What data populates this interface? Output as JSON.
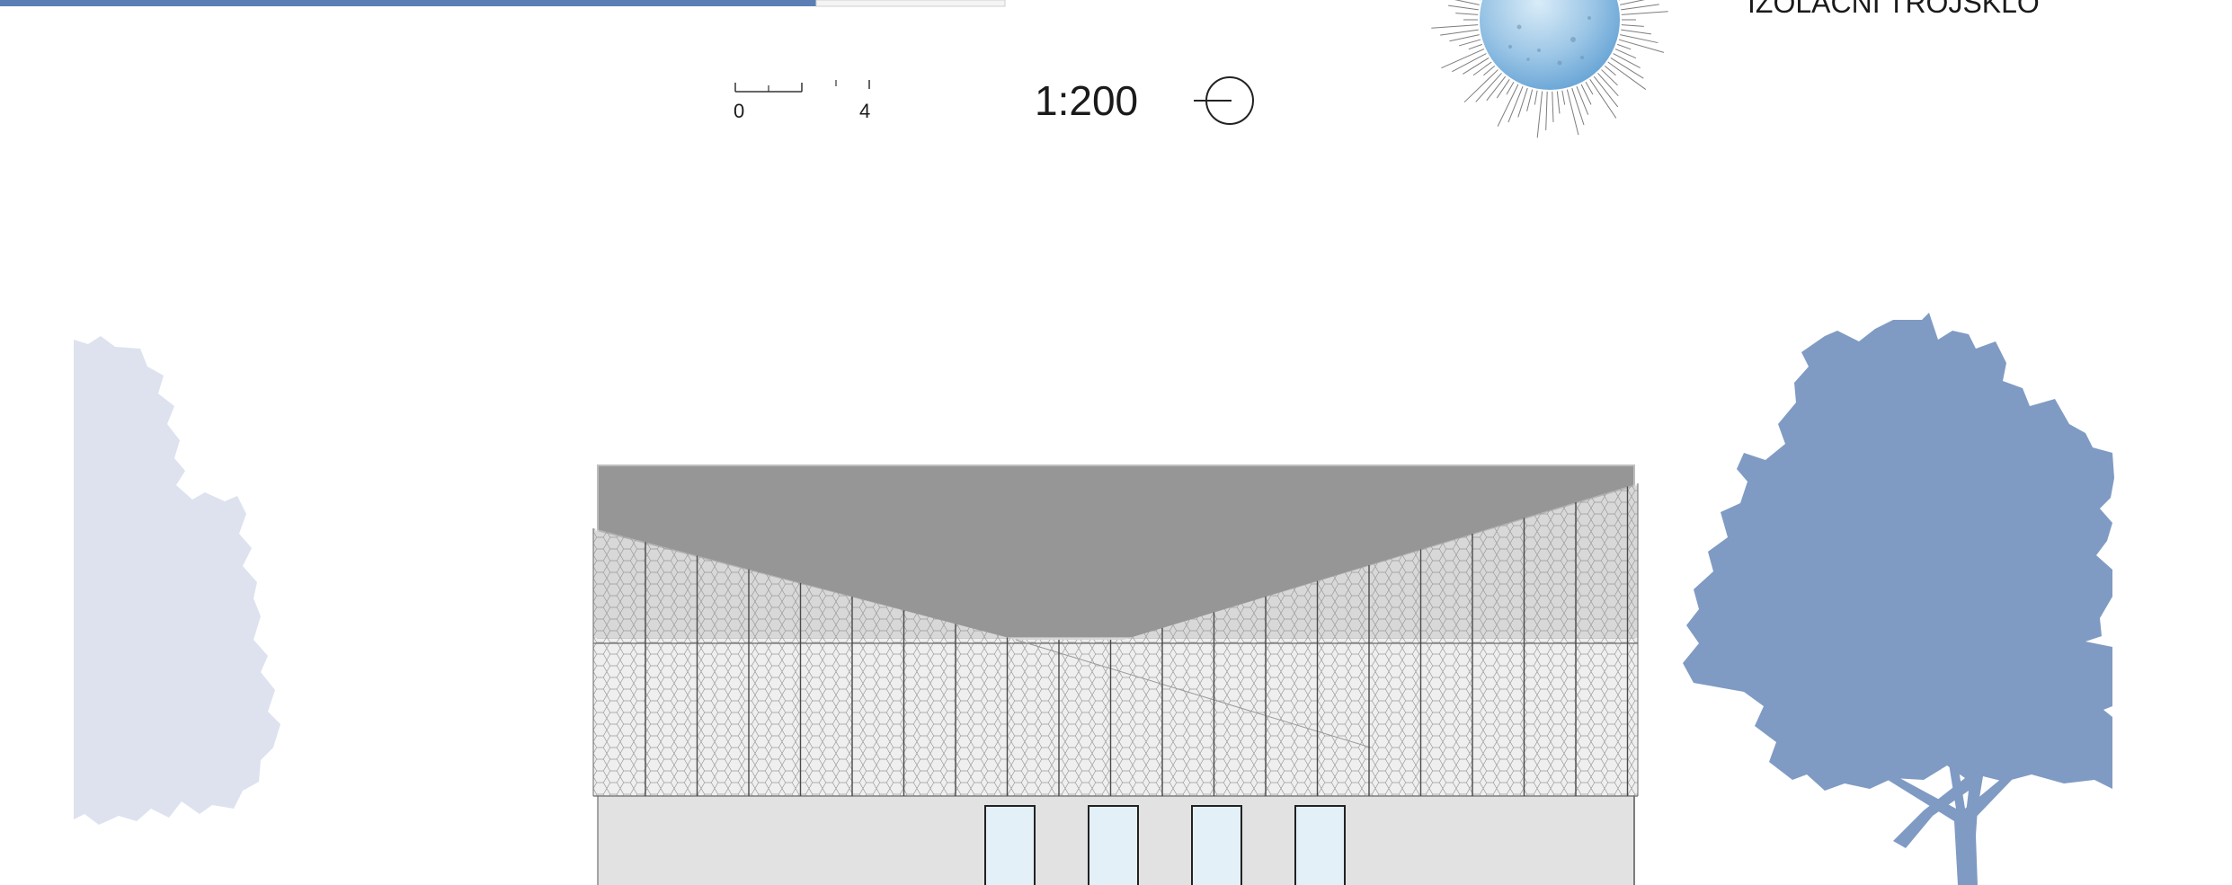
{
  "scale": {
    "bar_start_label": "0",
    "bar_end_label": "4",
    "ratio": "1:200"
  },
  "legend": {
    "glass_label": "IZOLAČNÍ TROJSKLO"
  },
  "colors": {
    "accent_blue": "#5b7fb4",
    "tree_dark": "#7f9bc4",
    "tree_light": "#dde2ee",
    "roof": "#969696",
    "facade_mesh": "#d9d9d9",
    "base_wall": "#e2e2e2",
    "window_glass": "#e3f0f8"
  },
  "icons": {
    "north_arrow": "north-arrow-icon",
    "glass_sphere": "glass-sphere-icon"
  }
}
